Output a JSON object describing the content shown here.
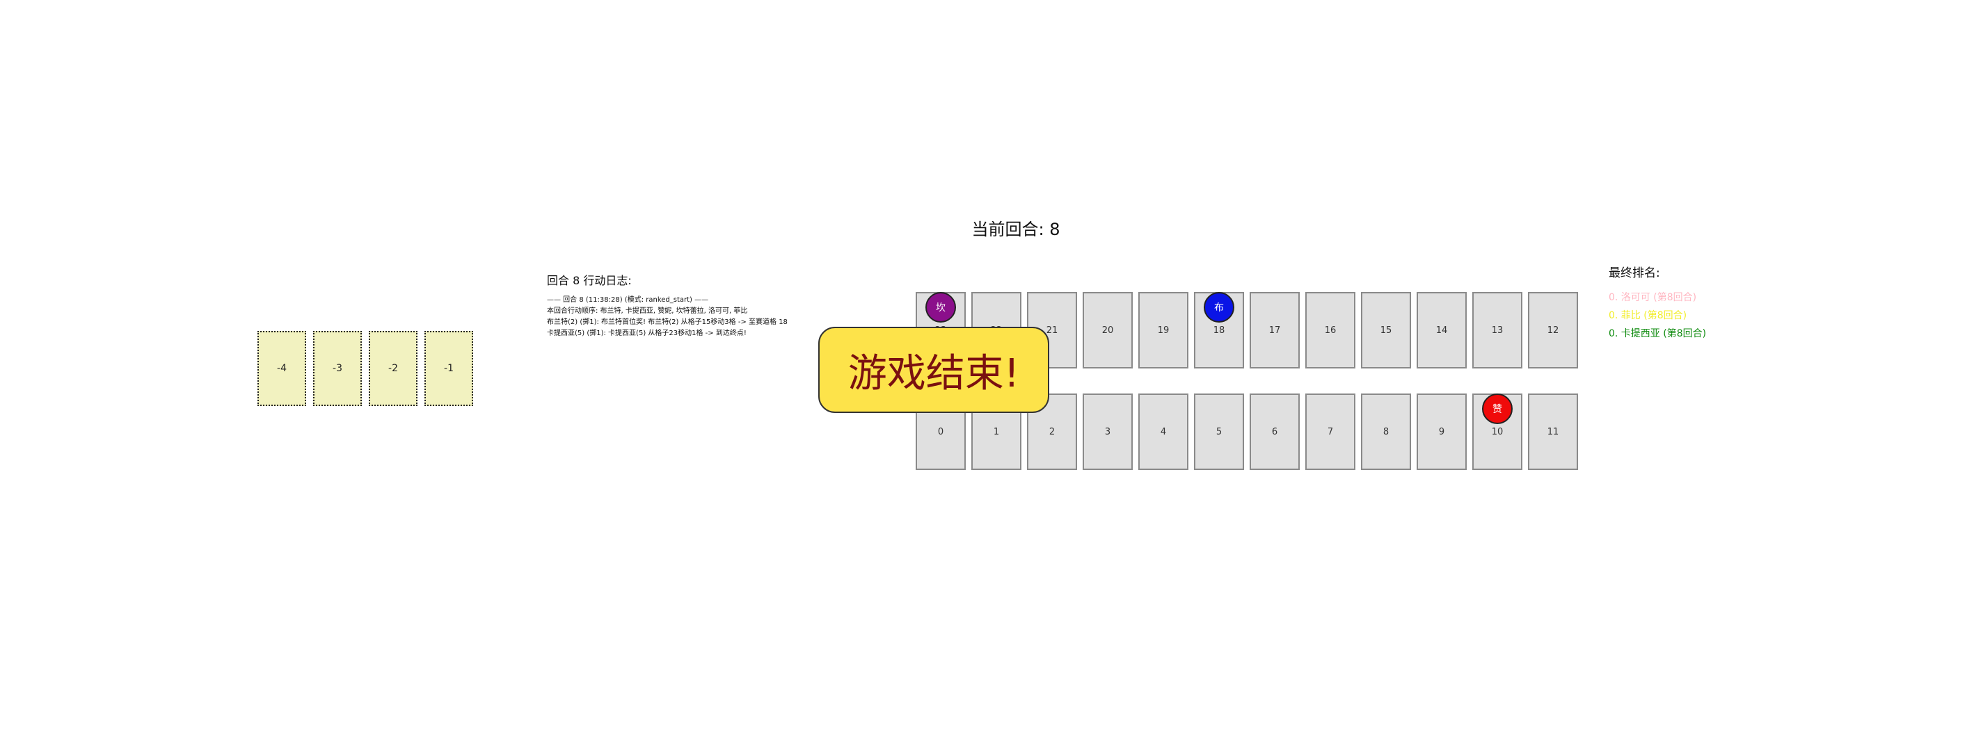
{
  "header": {
    "round_label": "当前回合: 8"
  },
  "start_cells": [
    "-4",
    "-3",
    "-2",
    "-1"
  ],
  "log": {
    "title": "回合 8 行动日志:",
    "lines": [
      "—— 回合 8 (11:38:28) (模式: ranked_start) ——",
      "本回合行动顺序: 布兰特, 卡提西亚, 赞妮, 坎特蕾拉, 洛可可, 菲比",
      "布兰特(2) (掷1): 布兰特首位奖! 布兰特(2) 从格子15移动3格 -> 至赛道格 18",
      "卡提西亚(5) (掷1): 卡提西亚(5) 从格子23移动1格 -> 到达终点!"
    ]
  },
  "board": {
    "top_row": [
      "23",
      "22",
      "21",
      "20",
      "19",
      "18",
      "17",
      "16",
      "15",
      "14",
      "13",
      "12"
    ],
    "bottom_row": [
      "0",
      "1",
      "2",
      "3",
      "4",
      "5",
      "6",
      "7",
      "8",
      "9",
      "10",
      "11"
    ]
  },
  "tokens": [
    {
      "label": "坎",
      "cell": "23",
      "color": "#8b0f8b"
    },
    {
      "label": "布",
      "cell": "18",
      "color": "#0a14e6"
    },
    {
      "label": "赞",
      "cell": "10",
      "color": "#f00a0a"
    }
  ],
  "overlay": {
    "game_over_text": "游戏结束!"
  },
  "ranking": {
    "title": "最终排名:",
    "items": [
      {
        "text": "0. 洛可可 (第8回合)",
        "color": "#ffb6c1"
      },
      {
        "text": "0. 菲比 (第8回合)",
        "color": "#f2ee2a"
      },
      {
        "text": "0. 卡提西亚 (第8回合)",
        "color": "#118c11"
      }
    ]
  }
}
